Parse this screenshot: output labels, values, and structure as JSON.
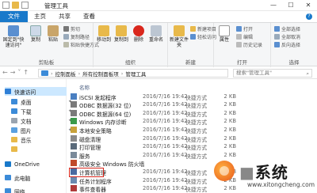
{
  "window": {
    "title": "管理工具",
    "controls": [
      "—",
      "☐",
      "✕"
    ]
  },
  "ribbon_tabs": [
    "文件",
    "主页",
    "共享",
    "查看"
  ],
  "ribbon": {
    "clipboard": {
      "pin_label": "固定到\"快速访问\"",
      "copy_label": "复制",
      "paste_label": "粘贴",
      "cut_label": "剪切",
      "copy_path_label": "复制路径",
      "paste_shortcut_label": "粘贴快捷方式",
      "group_label": "剪贴板"
    },
    "organize": {
      "move_label": "移动到",
      "copy_to_label": "复制到",
      "delete_label": "删除",
      "rename_label": "重命名",
      "group_label": "组织"
    },
    "new": {
      "new_folder_label": "新建文件夹",
      "new_item_label": "新建项目",
      "easy_access_label": "轻松访问",
      "group_label": "新建"
    },
    "open": {
      "properties_label": "属性",
      "open_label": "打开",
      "edit_label": "编辑",
      "history_label": "历史记录",
      "group_label": "打开"
    },
    "select": {
      "select_all_label": "全部选择",
      "select_none_label": "全部取消",
      "invert_label": "反向选择",
      "group_label": "选择"
    }
  },
  "address": {
    "path": [
      "控制面板",
      "所有控制面板项",
      "管理工具"
    ],
    "search_placeholder": "搜索\"管理工具\""
  },
  "sidebar": {
    "items": [
      {
        "label": "快速访问",
        "icon": "star-icon",
        "color": "#2f7fd6",
        "pinned": false
      },
      {
        "label": "桌面",
        "icon": "desktop-icon",
        "color": "#3c8bd8",
        "pinned": true
      },
      {
        "label": "下载",
        "icon": "download-icon",
        "color": "#3c8bd8",
        "pinned": true
      },
      {
        "label": "文档",
        "icon": "document-icon",
        "color": "#9aa4b0",
        "pinned": true
      },
      {
        "label": "图片",
        "icon": "picture-icon",
        "color": "#5aa0e0",
        "pinned": true
      },
      {
        "label": "音乐",
        "icon": "music-icon",
        "color": "#e8b94a",
        "pinned": false
      },
      {
        "label": "",
        "icon": "folder-icon",
        "color": "#e8b94a",
        "pinned": false
      },
      {
        "label": "OneDrive",
        "icon": "cloud-icon",
        "color": "#1979ca",
        "pinned": false
      },
      {
        "label": "此电脑",
        "icon": "computer-icon",
        "color": "#3c8bd8",
        "pinned": false
      },
      {
        "label": "网络",
        "icon": "network-icon",
        "color": "#3c8bd8",
        "pinned": false
      }
    ]
  },
  "columns": {
    "name": "名称"
  },
  "files": [
    {
      "name": "iSCSI 发起程序",
      "date": "2016/7/16 19:42",
      "type": "快捷方式",
      "size": "2 KB",
      "color": "#4a7fc1"
    },
    {
      "name": "ODBC 数据源(32 位)",
      "date": "2016/7/16 19:42",
      "type": "快捷方式",
      "size": "2 KB",
      "color": "#7a7a7a"
    },
    {
      "name": "ODBC 数据源(64 位)",
      "date": "2016/7/16 19:42",
      "type": "快捷方式",
      "size": "2 KB",
      "color": "#7a7a7a"
    },
    {
      "name": "Windows 内存诊断",
      "date": "2016/7/16 19:42",
      "type": "快捷方式",
      "size": "2 KB",
      "color": "#3a9a4a"
    },
    {
      "name": "本地安全策略",
      "date": "2016/7/16 19:42",
      "type": "快捷方式",
      "size": "2 KB",
      "color": "#c9a23a"
    },
    {
      "name": "磁盘清理",
      "date": "2016/7/16 19:42",
      "type": "快捷方式",
      "size": "2 KB",
      "color": "#8a8a8a"
    },
    {
      "name": "打印管理",
      "date": "2016/7/16 19:42",
      "type": "快捷方式",
      "size": "2 KB",
      "color": "#5a6a7a"
    },
    {
      "name": "服务",
      "date": "2016/7/16 19:42",
      "type": "快捷方式",
      "size": "2 KB",
      "color": "#7a8a9a"
    },
    {
      "name": "高级安全 Windows 防火墙",
      "date": "",
      "type": "",
      "size": "",
      "color": "#c04a2a"
    },
    {
      "name": "计算机管理",
      "date": "2016/7/16 19:42",
      "type": "快捷方式",
      "size": "2 KB",
      "color": "#4a6aa0"
    },
    {
      "name": "任务计划程序",
      "date": "2016/7/16 19:42",
      "type": "快捷方式",
      "size": "2 KB",
      "color": "#6a8ab0"
    },
    {
      "name": "事件查看器",
      "date": "2016/7/16 19:42",
      "type": "快捷方式",
      "size": "2 KB",
      "color": "#b03a3a"
    }
  ],
  "watermark": {
    "brand": "系统",
    "url": "www.xitongcheng.com"
  },
  "highlight_color": "#d9271c"
}
